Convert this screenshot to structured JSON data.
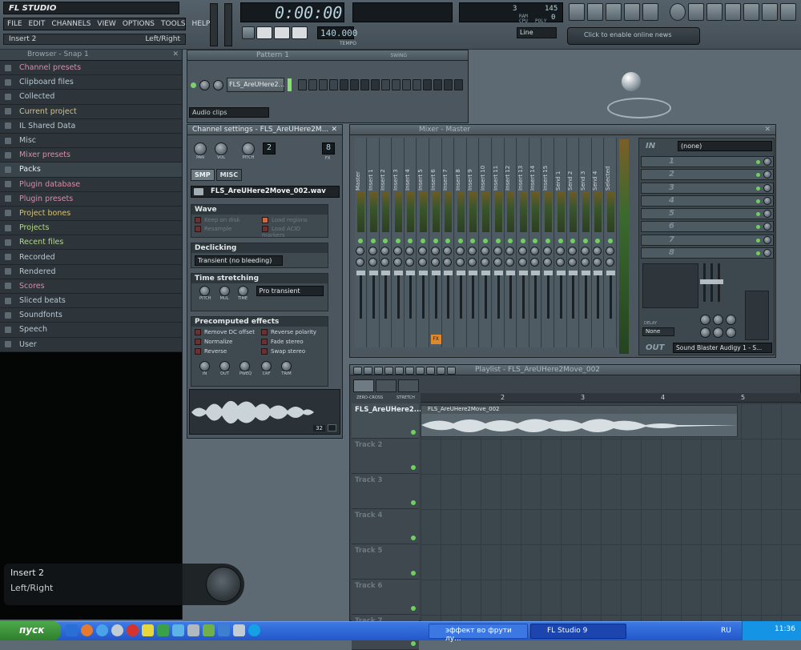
{
  "app": {
    "logo_text": "FL STUDIO"
  },
  "menu": [
    "FILE",
    "EDIT",
    "CHANNELS",
    "VIEW",
    "OPTIONS",
    "TOOLS",
    "HELP"
  ],
  "hint_bar": {
    "left": "Insert 2",
    "right": "Left/Right"
  },
  "transport": {
    "time": "0:00:00",
    "tempo": "140.000",
    "tempo_label": "TEMPO",
    "line_mode": "Line",
    "online_news": "Click to enable online news",
    "cpu_value": "3",
    "poly_value": "145",
    "ram_value": "0",
    "cpu_label": "CPU",
    "poly_label": "POLY",
    "ram_label": "RAM"
  },
  "browser": {
    "title": "Browser - Snap 1",
    "items": [
      {
        "label": "Channel presets",
        "color": "#d98ca8"
      },
      {
        "label": "Clipboard files",
        "color": "#b9c7d1"
      },
      {
        "label": "Collected",
        "color": "#b9c7d1"
      },
      {
        "label": "Current project",
        "color": "#d7c27a"
      },
      {
        "label": "IL Shared Data",
        "color": "#b9c7d1"
      },
      {
        "label": "Misc",
        "color": "#b9c7d1"
      },
      {
        "label": "Mixer presets",
        "color": "#d98ca8"
      },
      {
        "label": "Packs",
        "color": "#e8eef2"
      },
      {
        "label": "Plugin database",
        "color": "#d98ca8"
      },
      {
        "label": "Plugin presets",
        "color": "#d98ca8"
      },
      {
        "label": "Project bones",
        "color": "#d7c27a"
      },
      {
        "label": "Projects",
        "color": "#b7d88c"
      },
      {
        "label": "Recent files",
        "color": "#b7d88c"
      },
      {
        "label": "Recorded",
        "color": "#b9c7d1"
      },
      {
        "label": "Rendered",
        "color": "#b9c7d1"
      },
      {
        "label": "Scores",
        "color": "#d98ca8"
      },
      {
        "label": "Sliced beats",
        "color": "#b9c7d1"
      },
      {
        "label": "Soundfonts",
        "color": "#b9c7d1"
      },
      {
        "label": "Speech",
        "color": "#b9c7d1"
      },
      {
        "label": "User",
        "color": "#b9c7d1"
      }
    ],
    "selected_index": 7
  },
  "pattern": {
    "title": "Pattern 1",
    "swing_label": "SWING",
    "channel_name": "FLS_AreUHere2...",
    "audio_clips": "Audio clips"
  },
  "channel_settings": {
    "title": "Channel settings - FLS_AreUHere2M...",
    "knob_labels": [
      "PAN",
      "VOL",
      "PITCH"
    ],
    "pitch_range": "2",
    "fx_value": "8",
    "fx_label": "FX",
    "tabs": [
      "SMP",
      "MISC"
    ],
    "file": "FLS_AreUHere2Move_002.wav",
    "wave_title": "Wave",
    "wave_options": [
      "Keep on disk",
      "Resample",
      "Load regions",
      "Load ACID markers"
    ],
    "declicking_title": "Declicking",
    "declicking_value": "Transient (no bleeding)",
    "time_stretch_title": "Time stretching",
    "time_stretch_knobs": [
      "PITCH",
      "MUL",
      "TIME"
    ],
    "time_stretch_mode": "Pro transient",
    "precomputed_title": "Precomputed effects",
    "precomputed": [
      "Remove DC offset",
      "Reverse polarity",
      "Normalize",
      "Fade stereo",
      "Reverse",
      "Swap stereo"
    ],
    "effect_knobs": [
      "IN",
      "OUT",
      "PWEQ",
      "CRF",
      "TRIM"
    ],
    "sample_count": "32"
  },
  "mixer": {
    "title": "Mixer - Master",
    "strips": [
      "Master",
      "Insert 1",
      "Insert 2",
      "Insert 3",
      "Insert 4",
      "Insert 5",
      "Insert 6",
      "Insert 7",
      "Insert 8",
      "Insert 9",
      "Insert 10",
      "Insert 11",
      "Insert 12",
      "Insert 13",
      "Insert 14",
      "Insert 15",
      "Send 1",
      "Send 2",
      "Send 3",
      "Send 4",
      "Selected"
    ],
    "in_label": "IN",
    "in_value": "(none)",
    "slots": [
      "1",
      "2",
      "3",
      "4",
      "5",
      "6",
      "7",
      "8"
    ],
    "out_label": "OUT",
    "out_value": "Sound Blaster Audigy 1 - S...",
    "delay_label": "DELAY",
    "delay_value": "None",
    "fx_badge": "FX"
  },
  "playlist": {
    "title": "Playlist - FLS_AreUHere2Move_002",
    "zero_cross": "ZERO-CROSS",
    "stretch": "STRETCH",
    "bars": [
      "2",
      "3",
      "4",
      "5"
    ],
    "clip_name": "FLS_AreUHere2Move_002",
    "tracks": [
      "FLS_AreUHere2...",
      "Track 2",
      "Track 3",
      "Track 4",
      "Track 5",
      "Track 6",
      "Track 7"
    ]
  },
  "hint_overlay": {
    "line1": "Insert 2",
    "line2": "Left/Right"
  },
  "taskbar": {
    "start": "пуск",
    "tasks": [
      "эффект во фрути лу...",
      "FL Studio 9"
    ],
    "lang": "RU",
    "clock": "11:36"
  }
}
